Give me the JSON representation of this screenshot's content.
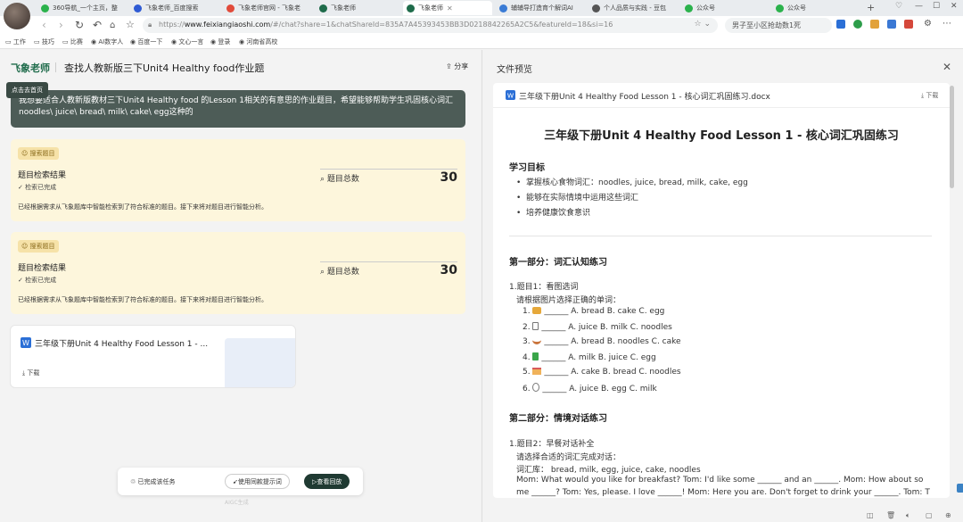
{
  "browser": {
    "tabs": [
      {
        "title": "360导航_一个主页，整",
        "color": "#2bb24c"
      },
      {
        "title": "飞象老师_百度搜索",
        "color": "#2f5bd4"
      },
      {
        "title": "飞象老师官网 - 飞象老",
        "color": "#e14b3b"
      },
      {
        "title": "飞象老师",
        "color": "#1e6b4a"
      },
      {
        "title": "飞象老师",
        "color": "#1e6b4a"
      },
      {
        "title": "辅辅导打造育个解词AI",
        "color": "#3a7bd5"
      },
      {
        "title": "个人品质与实践 - 豆包",
        "color": "#555555"
      },
      {
        "title": "公众号",
        "color": "#2bb24c"
      },
      {
        "title": "公众号",
        "color": "#2bb24c"
      }
    ],
    "url_prefix": "https://",
    "url_domain": "www.feixiangiaoshi.com",
    "url_rest": "/#/chat?share=1&chatShareId=835A7A45393453BB3D0218842265A2C5&featureId=18&si=16",
    "search_text": "男子至小区抢劫数1死",
    "bookmarks": [
      "工作",
      "技巧",
      "比赛",
      "AI数字人",
      "百度一下",
      "文心一言",
      "登录",
      "河南省高校"
    ]
  },
  "left": {
    "logo": "飞象老师",
    "title": "查找人教新版三下Unit4 Healthy food作业题",
    "share": "分享",
    "tooltip": "点击去首页",
    "message": "我想要适合人教新版教材三下Unit4 Healthy food 的Lesson 1相关的有意思的作业题目，希望能够帮助学生巩固核心词汇 noodles\\ juice\\ bread\\ milk\\ cake\\ egg这种的",
    "cards": [
      {
        "badge": "搜索题目",
        "result_title": "题目检索结果",
        "status": "检索已完成",
        "total_label": "题目总数",
        "total": "30",
        "desc": "已经根据需求从飞象题库中智能检索到了符合标准的题目。接下来将对题目进行智能分析。"
      },
      {
        "badge": "搜索题目",
        "result_title": "题目检索结果",
        "status": "检索已完成",
        "total_label": "题目总数",
        "total": "30",
        "desc": "已经根据需求从飞象题库中智能检索到了符合标准的题目。接下来将对题目进行智能分析。"
      }
    ],
    "file_card": {
      "name": "三年级下册Unit 4 Healthy Food Lesson 1 - ...",
      "download": "下载"
    },
    "bottom_bar": {
      "status": "已完成该任务",
      "btn_prompt": "使用同款提示词",
      "btn_replay": "查看回放"
    },
    "watermark": "AIGC生成"
  },
  "right": {
    "header": "文件预览",
    "file_name": "三年级下册Unit 4 Healthy Food Lesson 1 - 核心词汇巩固练习.docx",
    "download": "下载",
    "doc_title": "三年级下册Unit 4 Healthy Food Lesson 1 - 核心词汇巩固练习",
    "goals_heading": "学习目标",
    "goals": [
      "掌握核心食物词汇：noodles, juice, bread, milk, cake, egg",
      "能够在实际情境中运用这些词汇",
      "培养健康饮食意识"
    ],
    "part1_heading": "第一部分：词汇认知练习",
    "q1_title": "1.题目1：看图选词",
    "q1_instr": "请根据图片选择正确的单词：",
    "q1_items": [
      {
        "n": "1.",
        "text": "______ A. bread B. cake C. egg"
      },
      {
        "n": "2.",
        "text": "______ A. juice B. milk C. noodles"
      },
      {
        "n": "3.",
        "text": "______ A. bread B. noodles C. cake"
      },
      {
        "n": "4.",
        "text": "______ A. milk B. juice C. egg"
      },
      {
        "n": "5.",
        "text": "______ A. cake B. bread C. noodles"
      },
      {
        "n": "6.",
        "text": "______ A. juice B. egg C. milk"
      }
    ],
    "part2_heading": "第二部分：情境对话练习",
    "q2_title": "1.题目2：早餐对话补全",
    "q2_instr": "请选择合适的词汇完成对话：",
    "q2_bank": "词汇库： bread, milk, egg, juice, cake, noodles",
    "q2_line1": "Mom: What would you like for breakfast? Tom: I'd like some ______ and an ______. Mom: How about so",
    "q2_line2": "me ______? Tom: Yes, please. I love ______! Mom: Here you are. Don't forget to drink your ______. Tom: T"
  }
}
